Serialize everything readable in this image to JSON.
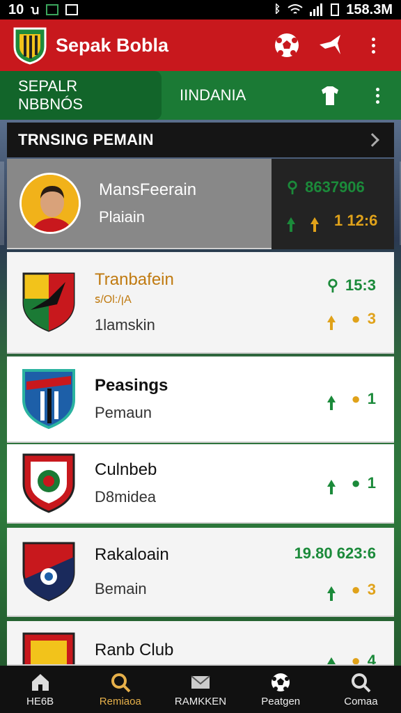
{
  "status_bar": {
    "time_left": "10",
    "time_right": "158.3M"
  },
  "app": {
    "title": "Sepak Bobla"
  },
  "tabs": [
    {
      "label": "SEPALR NBBNÓS"
    },
    {
      "label": "IINDANIA"
    }
  ],
  "section": {
    "title": "TRNSING PEMAIN"
  },
  "featured": {
    "name": "MansFeerain",
    "sub": "Plaiain",
    "stat_top": "8637906",
    "stat_bottom": "1 12:6"
  },
  "rows": [
    {
      "name": "Tranbafein",
      "extra": "ꜱ/Ol:/ꞁA",
      "sub": "1lamskin",
      "stat_top": "15:3",
      "stat_bottom": "3"
    },
    {
      "name": "Peasings",
      "sub": "Pemaun",
      "stat_bottom": "1"
    },
    {
      "name": "Culnbeb",
      "sub": "D8midea",
      "stat_bottom": "1"
    },
    {
      "name": "Rakaloain",
      "sub": "Bemain",
      "stat_top": "19.80 623:6",
      "stat_bottom": "3"
    },
    {
      "name": "Ranb Club",
      "sub": "",
      "stat_bottom": "4"
    }
  ],
  "bottom_nav": [
    {
      "label": "HE6B",
      "icon": "home-icon"
    },
    {
      "label": "Remiaoa",
      "icon": "search-icon"
    },
    {
      "label": "RAMKKEN",
      "icon": "mail-icon"
    },
    {
      "label": "Peatgen",
      "icon": "soccer-ball-icon"
    },
    {
      "label": "Comaa",
      "icon": "search-icon"
    }
  ]
}
